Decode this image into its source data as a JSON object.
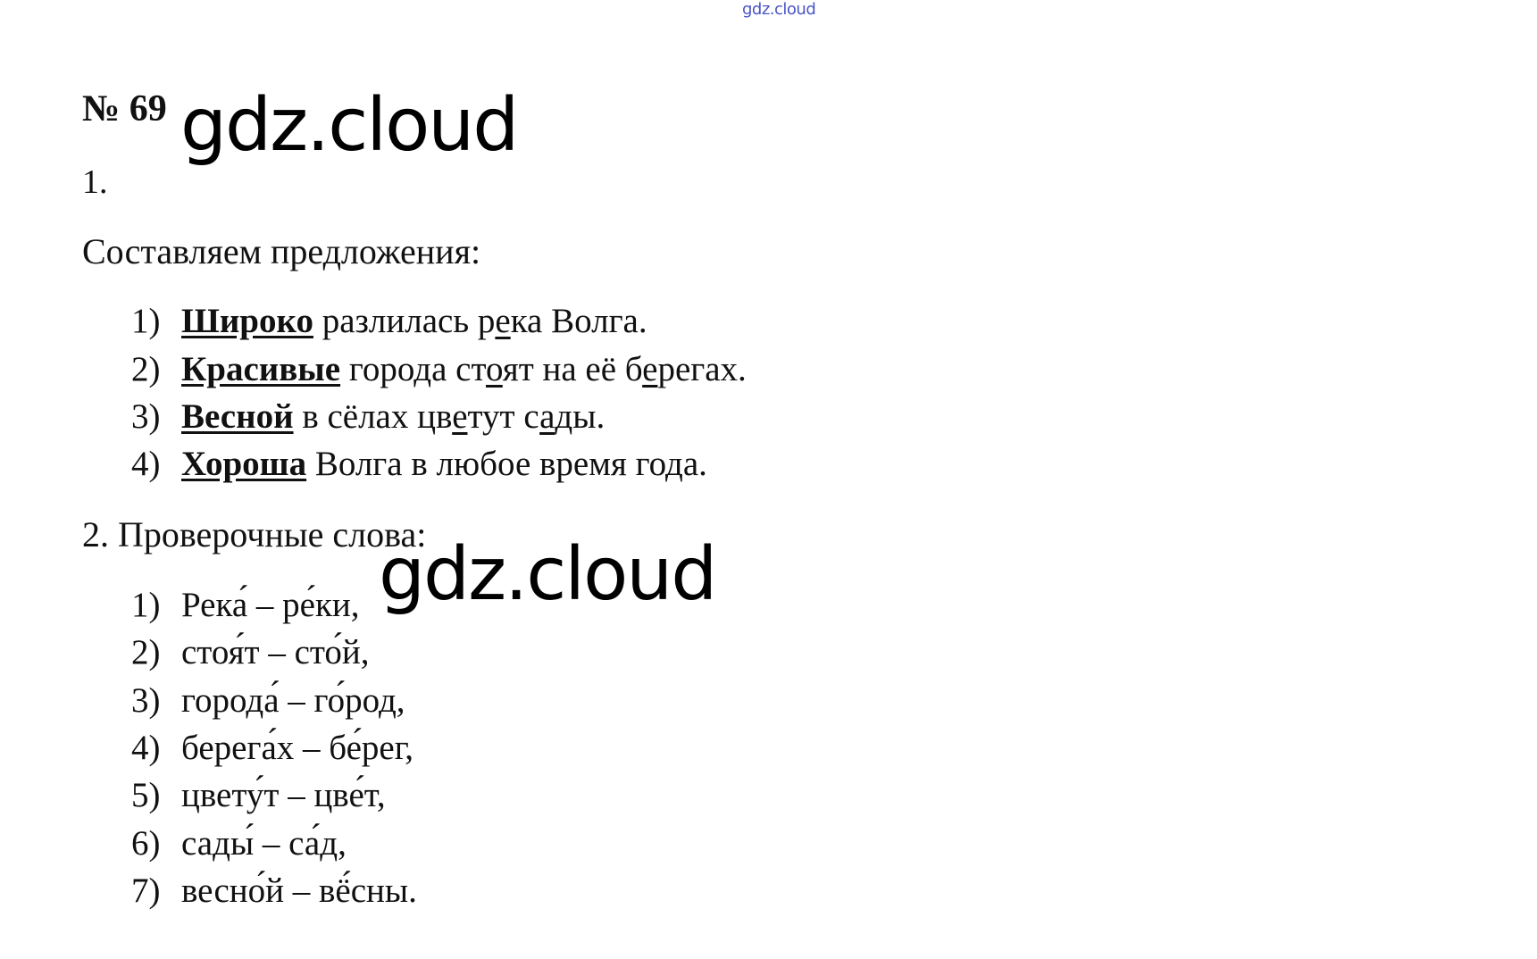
{
  "watermark_top": "gdz.cloud",
  "watermark_large": "gdz.cloud",
  "task": {
    "number": "№ 69",
    "section1_label": "1.",
    "intro": "Составляем предложения:",
    "sentences": [
      {
        "n": "1)",
        "kw": "Широко",
        "p1": " разлилась р",
        "u1": "е",
        "p2": "ка Волга.",
        "u2": "",
        "p3": ""
      },
      {
        "n": "2)",
        "kw": "Красивые",
        "p1": " города ст",
        "u1": "о",
        "p2": "ят на её б",
        "u2": "е",
        "p3": "регах."
      },
      {
        "n": "3)",
        "kw": "Весной",
        "p1": " в сёлах цв",
        "u1": "е",
        "p2": "тут с",
        "u2": "а",
        "p3": "ды."
      },
      {
        "n": "4)",
        "kw": "Хороша",
        "p1": " Волга в любое время года.",
        "u1": "",
        "p2": "",
        "u2": "",
        "p3": ""
      }
    ],
    "section2_label": "2. Проверочные слова:",
    "checks": [
      {
        "n": "1)",
        "text": "Река́ – ре́ки,"
      },
      {
        "n": "2)",
        "text": "стоя́т – сто́й,"
      },
      {
        "n": "3)",
        "text": "города́ – го́род,"
      },
      {
        "n": "4)",
        "text": "берега́х – бе́рег,"
      },
      {
        "n": "5)",
        "text": "цвету́т – цве́т,"
      },
      {
        "n": "6)",
        "text": "сады́ – са́д,"
      },
      {
        "n": "7)",
        "text": "весно́й – вё́сны."
      }
    ]
  }
}
